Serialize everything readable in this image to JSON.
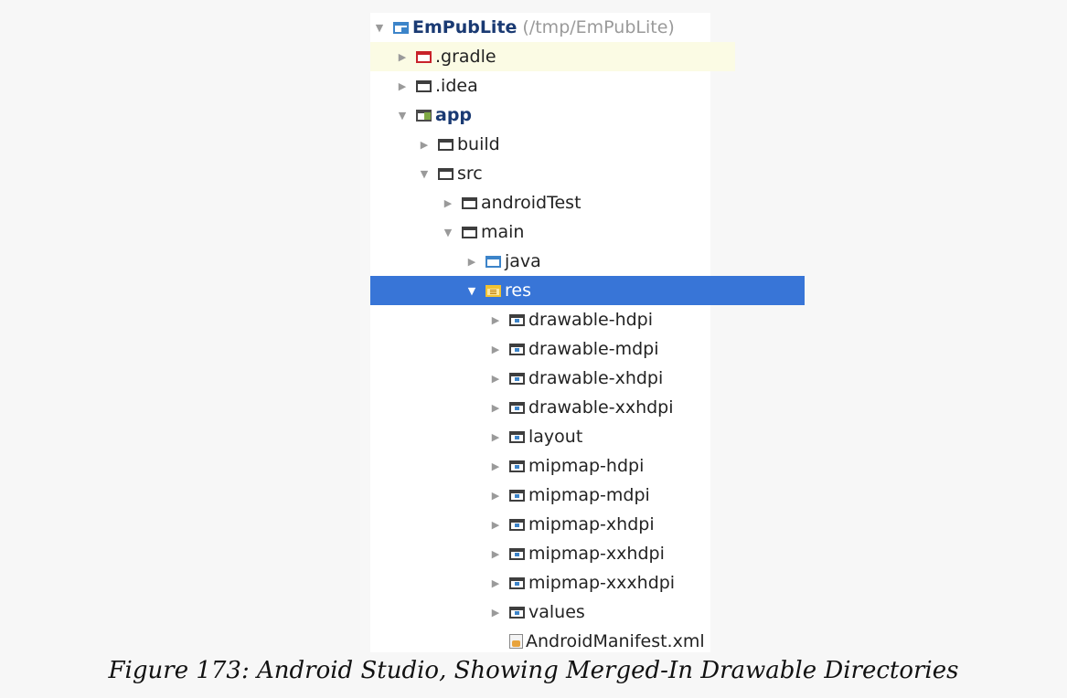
{
  "project_tree": {
    "root": {
      "name": "EmPubLite",
      "path": "(/tmp/EmPubLite)",
      "icon": "project-icon"
    },
    "items": [
      {
        "label": ".gradle",
        "icon": "folder-icon"
      },
      {
        "label": ".idea",
        "icon": "folder-icon"
      },
      {
        "label": "app",
        "icon": "module-icon"
      },
      {
        "label": "build",
        "icon": "folder-icon"
      },
      {
        "label": "src",
        "icon": "folder-icon"
      },
      {
        "label": "androidTest",
        "icon": "folder-icon"
      },
      {
        "label": "main",
        "icon": "folder-icon"
      },
      {
        "label": "java",
        "icon": "folder-icon"
      },
      {
        "label": "res",
        "icon": "res-folder-icon"
      },
      {
        "label": "drawable-hdpi",
        "icon": "resource-folder-icon"
      },
      {
        "label": "drawable-mdpi",
        "icon": "resource-folder-icon"
      },
      {
        "label": "drawable-xhdpi",
        "icon": "resource-folder-icon"
      },
      {
        "label": "drawable-xxhdpi",
        "icon": "resource-folder-icon"
      },
      {
        "label": "layout",
        "icon": "resource-folder-icon"
      },
      {
        "label": "mipmap-hdpi",
        "icon": "resource-folder-icon"
      },
      {
        "label": "mipmap-mdpi",
        "icon": "resource-folder-icon"
      },
      {
        "label": "mipmap-xhdpi",
        "icon": "resource-folder-icon"
      },
      {
        "label": "mipmap-xxhdpi",
        "icon": "resource-folder-icon"
      },
      {
        "label": "mipmap-xxxhdpi",
        "icon": "resource-folder-icon"
      },
      {
        "label": "values",
        "icon": "resource-folder-icon"
      },
      {
        "label": "AndroidManifest.xml",
        "icon": "manifest-file-icon"
      }
    ],
    "selected_item": "res",
    "colors": {
      "selection": "#3875d7",
      "highlight_row": "#fbfbe4",
      "excluded_folder": "#c8222a",
      "source_folder": "#3c84c9",
      "resource_folder": "#f1c232"
    }
  },
  "caption": "Figure 173: Android Studio, Showing Merged-In Drawable Directories"
}
